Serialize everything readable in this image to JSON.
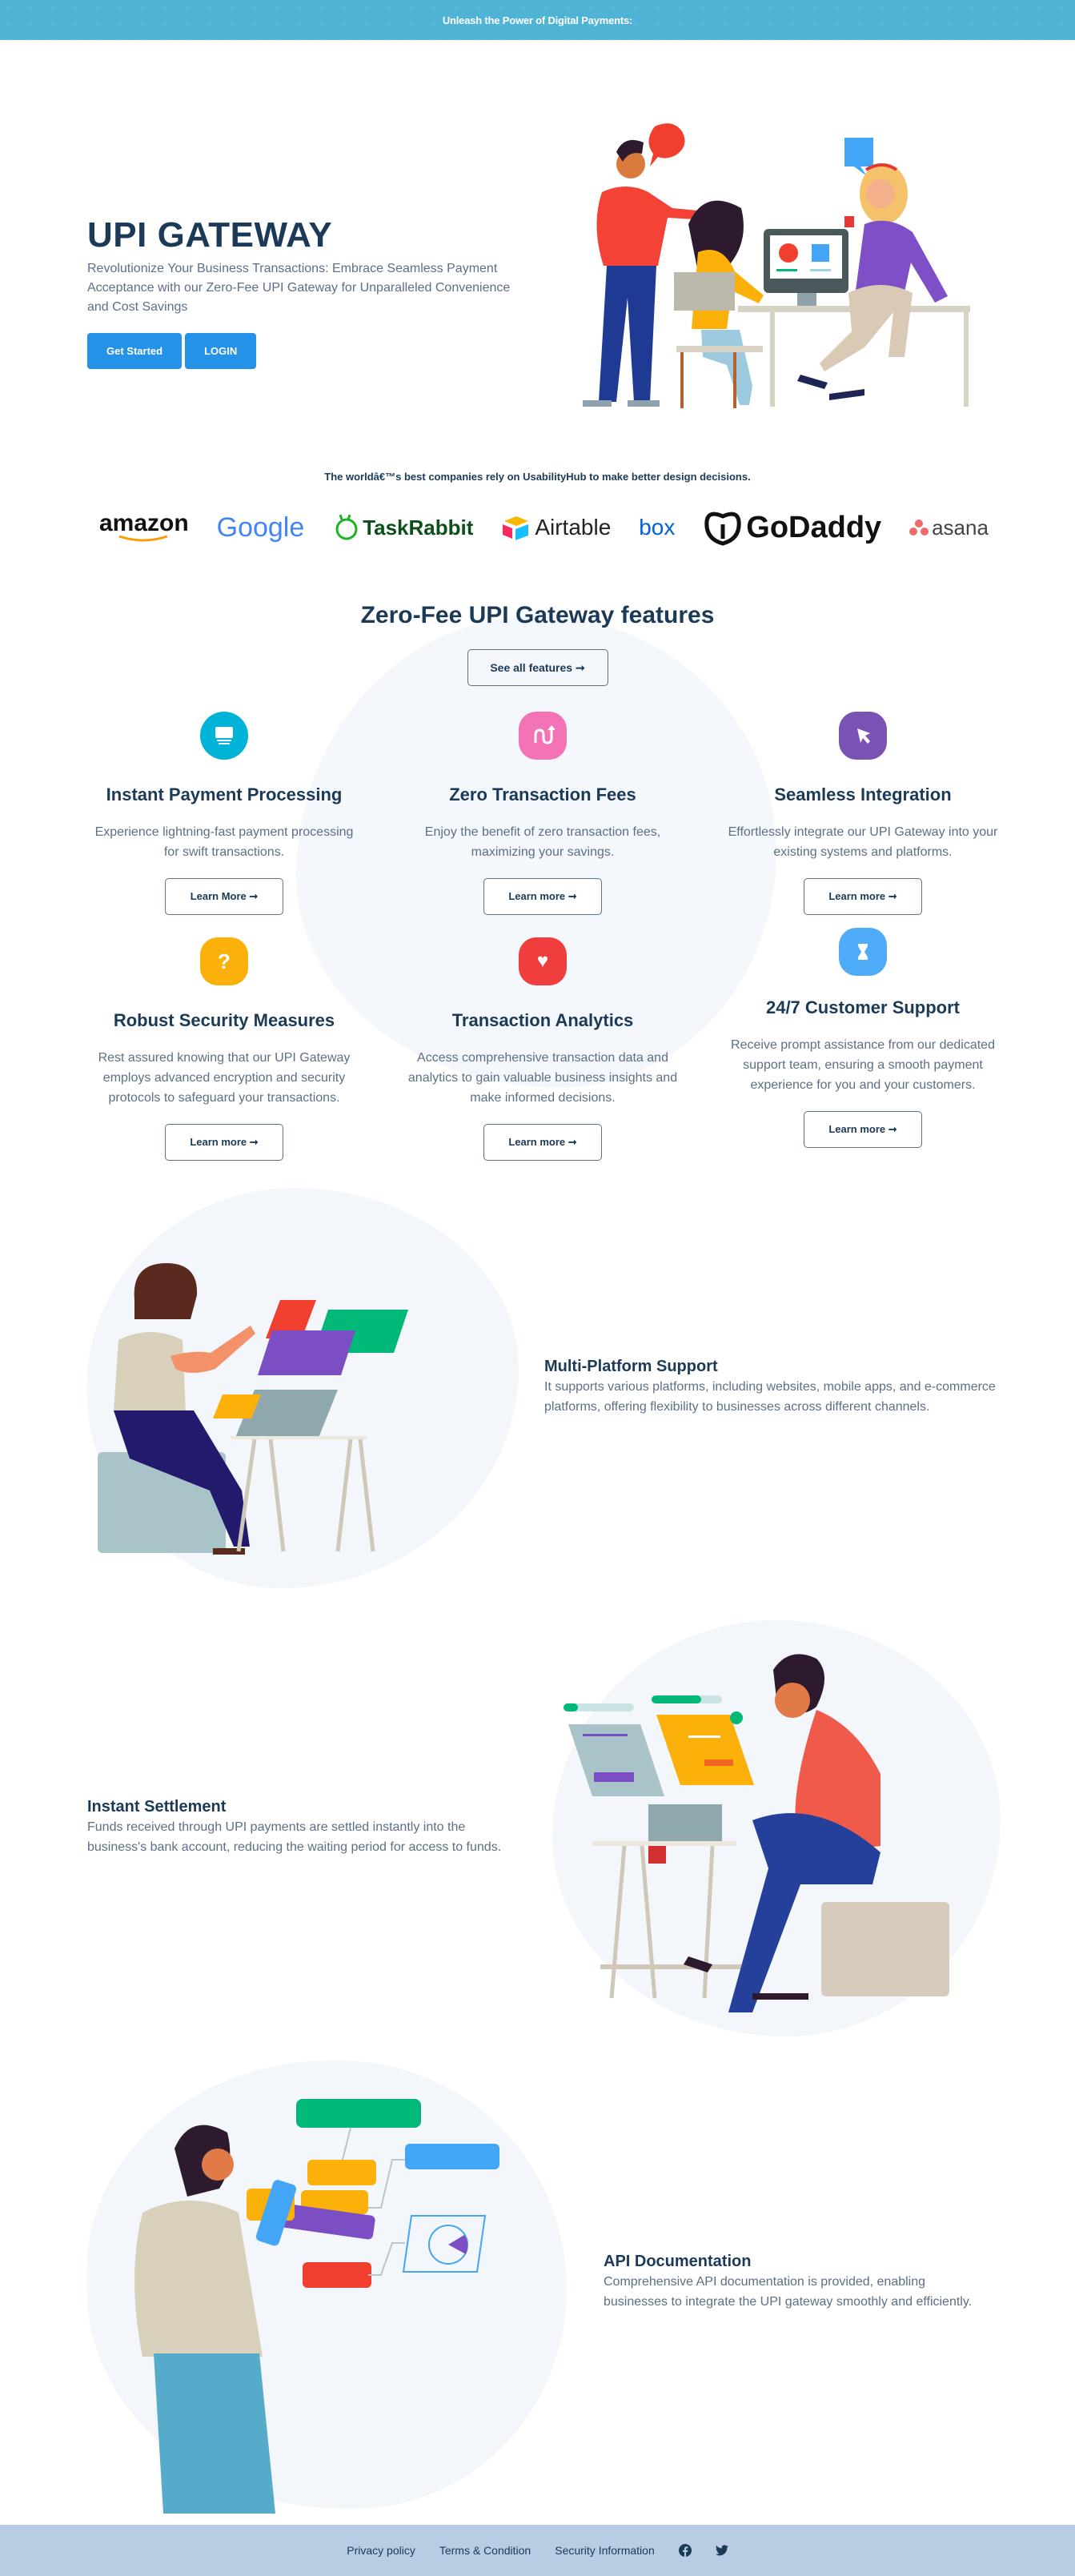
{
  "banner": {
    "text": "Unleash the Power of Digital Payments:"
  },
  "hero": {
    "title": "UPI GATEWAY",
    "subtitle": "Revolutionize Your Business Transactions: Embrace Seamless Payment Acceptance with our Zero-Fee UPI Gateway for Unparalleled Convenience and Cost Savings",
    "get_started_label": "Get Started",
    "login_label": "LOGIN"
  },
  "trusted": {
    "text": "The worldâ€™s best companies rely on UsabilityHub to make better design decisions.",
    "logos": [
      "amazon",
      "Google",
      "TaskRabbit",
      "Airtable",
      "box",
      "GoDaddy",
      "asana"
    ]
  },
  "features": {
    "title": "Zero-Fee UPI Gateway features",
    "see_all_label": "See all features ➞",
    "items": [
      {
        "icon": "monitor-icon",
        "color": "#00b4d8",
        "title": "Instant Payment Processing",
        "desc": "Experience lightning-fast payment processing for swift transactions.",
        "button": "Learn More ➞"
      },
      {
        "icon": "route-arrow-icon",
        "color": "#f472b6",
        "title": "Zero Transaction Fees",
        "desc": "Enjoy the benefit of zero transaction fees, maximizing your savings.",
        "button": "Learn more ➞"
      },
      {
        "icon": "cursor-icon",
        "color": "#7952b3",
        "title": "Seamless Integration",
        "desc": "Effortlessly integrate our UPI Gateway into your existing systems and platforms.",
        "button": "Learn more ➞"
      },
      {
        "icon": "question-icon",
        "color": "#fbb00a",
        "title": "Robust Security Measures",
        "desc": "Rest assured knowing that our UPI Gateway employs advanced encryption and security protocols to safeguard your transactions.",
        "button": "Learn more ➞"
      },
      {
        "icon": "heart-icon",
        "color": "#f03e3e",
        "title": "Transaction Analytics",
        "desc": "Access comprehensive transaction data and analytics to gain valuable business insights and make informed decisions.",
        "button": "Learn more ➞"
      },
      {
        "icon": "hourglass-icon",
        "color": "#4dabf7",
        "title": "24/7 Customer Support",
        "desc": "Receive prompt assistance from our dedicated support team, ensuring a smooth payment experience for you and your customers.",
        "button": "Learn more ➞"
      }
    ]
  },
  "showcase": [
    {
      "title": "Multi-Platform Support",
      "desc": "It supports various platforms, including websites, mobile apps, and e-commerce platforms, offering flexibility to businesses across different channels."
    },
    {
      "title": "Instant Settlement",
      "desc": "Funds received through UPI payments are settled instantly into the business's bank account, reducing the waiting period for access to funds."
    },
    {
      "title": "API Documentation",
      "desc": "Comprehensive API documentation is provided, enabling businesses to integrate the UPI gateway smoothly and efficiently."
    }
  ],
  "footer": {
    "links": [
      "Privacy policy",
      "Terms & Condition",
      "Security Information"
    ],
    "social": [
      "facebook-icon",
      "twitter-icon"
    ]
  }
}
